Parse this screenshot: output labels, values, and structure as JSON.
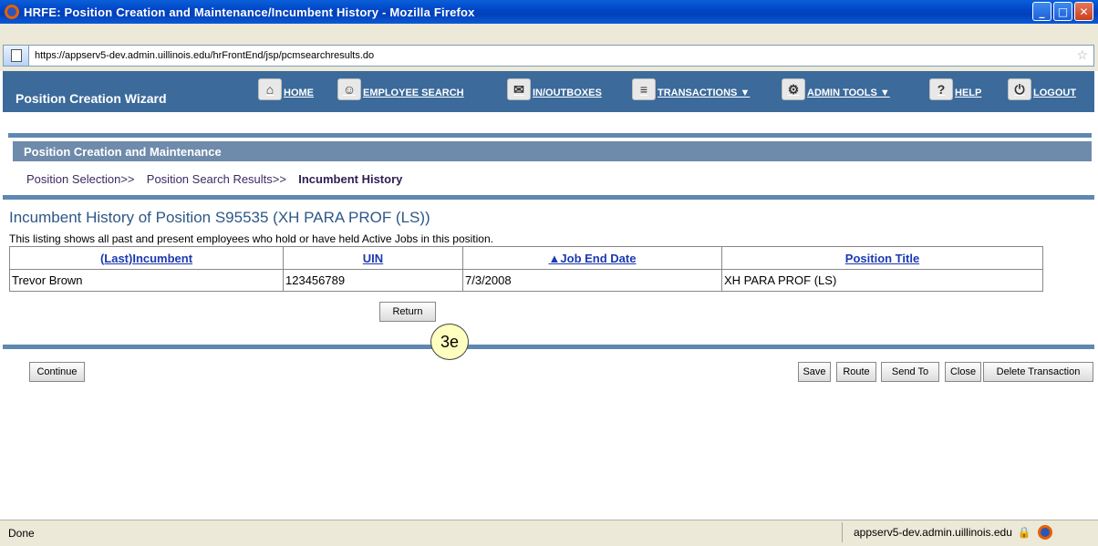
{
  "window": {
    "title": "HRFE: Position Creation and Maintenance/Incumbent History - Mozilla Firefox",
    "minimize": "_",
    "maximize": "□",
    "close": "✕"
  },
  "browser": {
    "url": "https://appserv5-dev.admin.uillinois.edu/hrFrontEnd/jsp/pcmsearchresults.do",
    "status": "Done",
    "host": "appserv5-dev.admin.uillinois.edu"
  },
  "app": {
    "title": "Position Creation Wizard",
    "nav": [
      {
        "label": "HOME",
        "icon": "home-icon"
      },
      {
        "label": "EMPLOYEE SEARCH",
        "icon": "employee-search-icon"
      },
      {
        "label": "IN/OUTBOXES",
        "icon": "inbox-icon"
      },
      {
        "label": "TRANSACTIONS ▼",
        "icon": "transactions-icon"
      },
      {
        "label": "ADMIN TOOLS ▼",
        "icon": "admin-tools-icon"
      },
      {
        "label": "HELP",
        "icon": "help-icon"
      },
      {
        "label": "LOGOUT",
        "icon": "logout-icon"
      }
    ]
  },
  "section": {
    "title": "Position Creation and Maintenance"
  },
  "breadcrumb": {
    "item1": "Position Selection>>",
    "item2": "Position Search Results>>",
    "current": "Incumbent History"
  },
  "page": {
    "heading": "Incumbent History of Position S95535 (XH PARA PROF (LS))",
    "description": "This listing shows all past and present employees who hold or have held Active Jobs in this position."
  },
  "table": {
    "headers": [
      "(Last)Incumbent",
      "UIN",
      "▲Job End Date",
      "Position Title"
    ],
    "rows": [
      [
        "Trevor Brown",
        "123456789",
        "7/3/2008",
        "XH PARA PROF (LS)"
      ]
    ]
  },
  "buttons": {
    "return": "Return",
    "continue": "Continue",
    "save": "Save",
    "route": "Route",
    "send_to": "Send To",
    "close": "Close",
    "delete": "Delete Transaction"
  },
  "callout": "3e"
}
